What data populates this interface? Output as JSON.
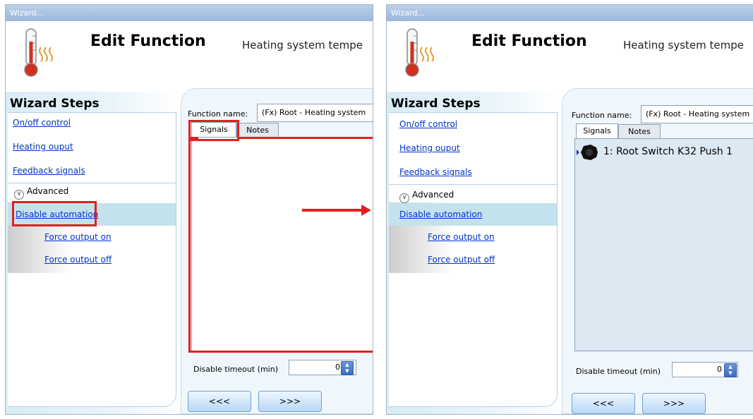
{
  "window": {
    "title": "Wizard..."
  },
  "header": {
    "title": "Edit Function",
    "subtitle": "Heating system tempe"
  },
  "steps": {
    "title": "Wizard Steps",
    "items": [
      {
        "label": "On/off control"
      },
      {
        "label": "Heating ouput"
      },
      {
        "label": "Feedback signals"
      }
    ],
    "advanced_label": "Advanced",
    "advanced_items": [
      {
        "label": "Disable automation"
      },
      {
        "label": "Force output on"
      },
      {
        "label": "Force output off"
      }
    ]
  },
  "form": {
    "function_name_label": "Function name:",
    "function_name_value": "(Fx) Root - Heating system",
    "tabs": [
      "Signals",
      "Notes"
    ],
    "timeout_label": "Disable timeout (min)",
    "timeout_value": "0"
  },
  "signal_item": "1: Root Switch K32 Push 1",
  "nav": {
    "back": "<<<",
    "next": ">>>"
  },
  "colors": {
    "highlight": "#c4e2ee",
    "annotation": "#e02020",
    "link": "#0033cc"
  },
  "icons": {
    "thermometer": "thermometer-icon",
    "expand": "chevron-down-icon",
    "spinner": "spinner-icon",
    "signal": "push-button-icon"
  }
}
